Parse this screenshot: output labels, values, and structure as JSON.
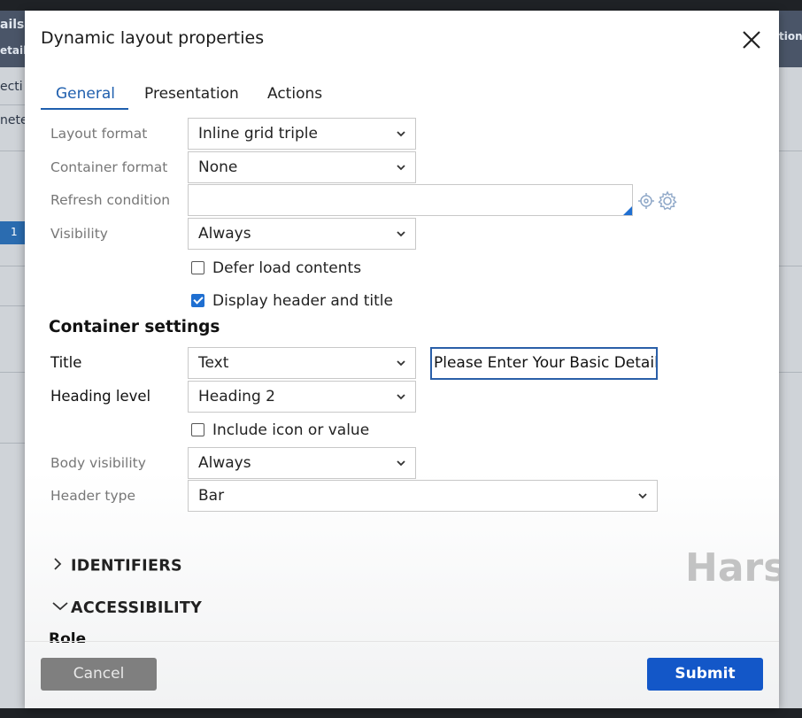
{
  "background": {
    "left_texts": [
      "ails:",
      "etail",
      "ecti",
      "nete"
    ],
    "right_text": "tion",
    "left_row_number": "1"
  },
  "dialog": {
    "title": "Dynamic layout properties",
    "close_glyph": "✕"
  },
  "tabs": [
    {
      "label": "General",
      "active": true
    },
    {
      "label": "Presentation",
      "active": false
    },
    {
      "label": "Actions",
      "active": false
    }
  ],
  "general": {
    "layout_format": {
      "label": "Layout format",
      "value": "Inline grid triple"
    },
    "container_format": {
      "label": "Container format",
      "value": "None"
    },
    "refresh_condition": {
      "label": "Refresh condition",
      "value": ""
    },
    "visibility": {
      "label": "Visibility",
      "value": "Always"
    },
    "defer_load": {
      "label": "Defer load contents",
      "checked": false
    },
    "display_header": {
      "label": "Display header and title",
      "checked": true
    }
  },
  "container_settings": {
    "heading": "Container settings",
    "title": {
      "label": "Title",
      "value": "Text",
      "text_value": "Please Enter Your Basic Details"
    },
    "heading_level": {
      "label": "Heading level",
      "value": "Heading 2"
    },
    "include_icon": {
      "label": "Include icon or value",
      "checked": false
    },
    "body_visibility": {
      "label": "Body visibility",
      "value": "Always"
    },
    "header_type": {
      "label": "Header type",
      "value": "Bar"
    }
  },
  "sections": {
    "identifiers": {
      "label": "IDENTIFIERS",
      "expanded": false
    },
    "accessibility": {
      "label": "ACCESSIBILITY",
      "expanded": true
    },
    "role_label": "Role"
  },
  "watermark": "Harsha",
  "footer": {
    "cancel_label": "Cancel",
    "submit_label": "Submit"
  },
  "colors": {
    "accent": "#1f5fae",
    "submit": "#1357c8",
    "cancel": "#7f7f7f"
  }
}
